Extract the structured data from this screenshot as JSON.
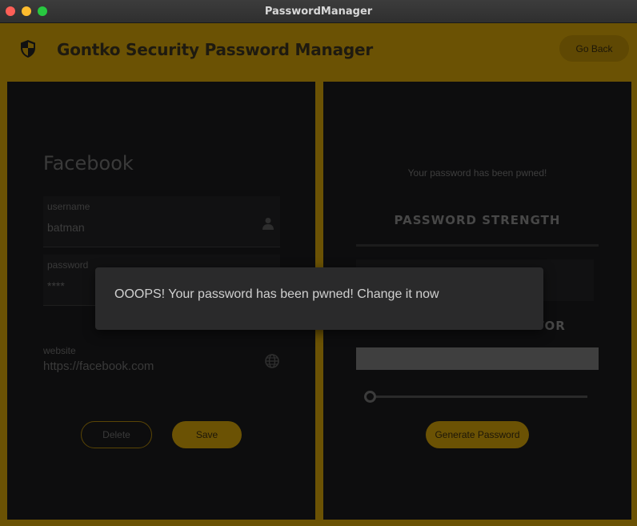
{
  "window": {
    "title": "PasswordManager"
  },
  "header": {
    "title": "Gontko Security Password Manager",
    "go_back_label": "Go Back"
  },
  "entry": {
    "name": "Facebook",
    "username_label": "username",
    "username_value": "batman",
    "password_label": "password",
    "password_value": "****",
    "website_label": "website",
    "website_value": "https://facebook.com",
    "delete_label": "Delete",
    "save_label": "Save"
  },
  "checker": {
    "status_text": "Your password has been pwned!",
    "strength_title": "PASSWORD STRENGTH",
    "strength_level": 0
  },
  "generator": {
    "title": "PASSWORD GENERATOR",
    "output_value": "",
    "length_level": 0,
    "generate_label": "Generate Password"
  },
  "toast": {
    "message": "OOOPS! Your password has been pwned! Change it now"
  },
  "colors": {
    "accent": "#6b5204",
    "panel": "#0d0d0e",
    "toast": "#2a2a2b"
  }
}
